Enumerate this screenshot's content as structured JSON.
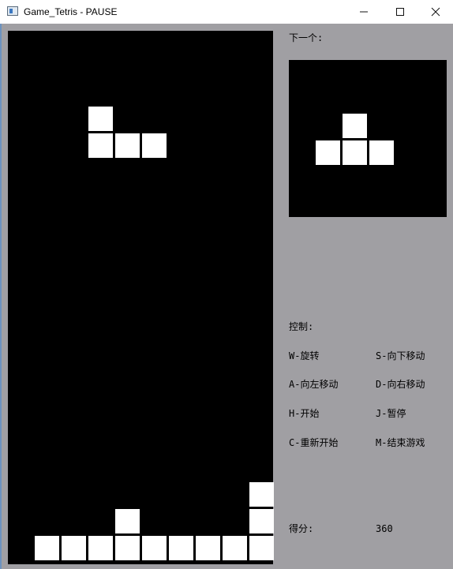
{
  "window": {
    "title": "Game_Tetris - PAUSE",
    "controls": [
      "minimize-icon",
      "maximize-icon",
      "close-icon"
    ]
  },
  "game": {
    "board_columns": 10,
    "board_rows": 20,
    "colors": {
      "background": "#000000",
      "block": "#ffffff",
      "panel": "#a09fa3",
      "title_bar": "#ffffff"
    },
    "current_piece": {
      "type": "J",
      "cells": [
        [
          3,
          3
        ],
        [
          3,
          4
        ],
        [
          4,
          4
        ],
        [
          5,
          4
        ]
      ]
    },
    "stack": [
      [
        4,
        18
      ],
      [
        9,
        17
      ],
      [
        9,
        18
      ],
      [
        1,
        19
      ],
      [
        2,
        19
      ],
      [
        3,
        19
      ],
      [
        4,
        19
      ],
      [
        5,
        19
      ],
      [
        6,
        19
      ],
      [
        7,
        19
      ],
      [
        8,
        19
      ],
      [
        9,
        19
      ]
    ]
  },
  "next_piece": {
    "label": "下一个:",
    "type": "T",
    "cells": [
      [
        1,
        0
      ],
      [
        0,
        1
      ],
      [
        1,
        1
      ],
      [
        2,
        1
      ]
    ]
  },
  "controls": {
    "title": "控制:",
    "items": [
      "W-旋转",
      "S-向下移动",
      "A-向左移动",
      "D-向右移动",
      "H-开始",
      "J-暂停",
      "C-重新开始",
      "M-结束游戏"
    ]
  },
  "score": {
    "label": "得分:",
    "value": "360"
  }
}
